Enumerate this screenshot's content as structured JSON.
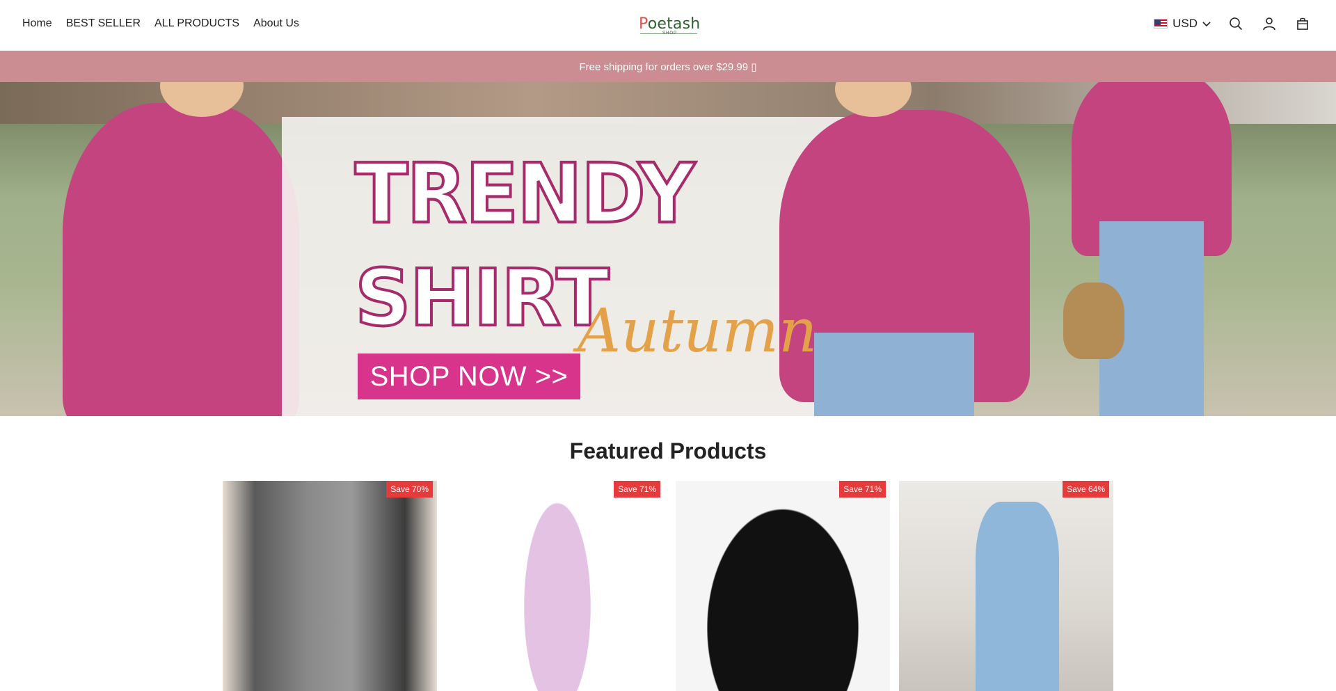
{
  "nav": {
    "items": [
      {
        "label": "Home"
      },
      {
        "label": "BEST SELLER"
      },
      {
        "label": "ALL PRODUCTS"
      },
      {
        "label": "About Us"
      }
    ]
  },
  "logo": {
    "text_initial": "P",
    "text_rest": "oetash",
    "sub": "SHOP"
  },
  "tools": {
    "currency": "USD",
    "icons": [
      "search-icon",
      "account-icon",
      "cart-icon"
    ]
  },
  "announcement": {
    "text": "Free shipping for orders over $29.99 ▯"
  },
  "hero": {
    "line1": "TRENDY",
    "line2": "SHIRT",
    "script": "Autumn",
    "cta": "SHOP NOW >>"
  },
  "featured": {
    "title": "Featured Products",
    "products": [
      {
        "badge": "Save 70%"
      },
      {
        "badge": "Save 71%"
      },
      {
        "badge": "Save 71%"
      },
      {
        "badge": "Save 64%"
      }
    ]
  },
  "colors": {
    "announcement_bg": "#cc8d92",
    "badge": "#e63b3b",
    "cta": "#d8348c",
    "accent_script": "#e3a24a"
  }
}
